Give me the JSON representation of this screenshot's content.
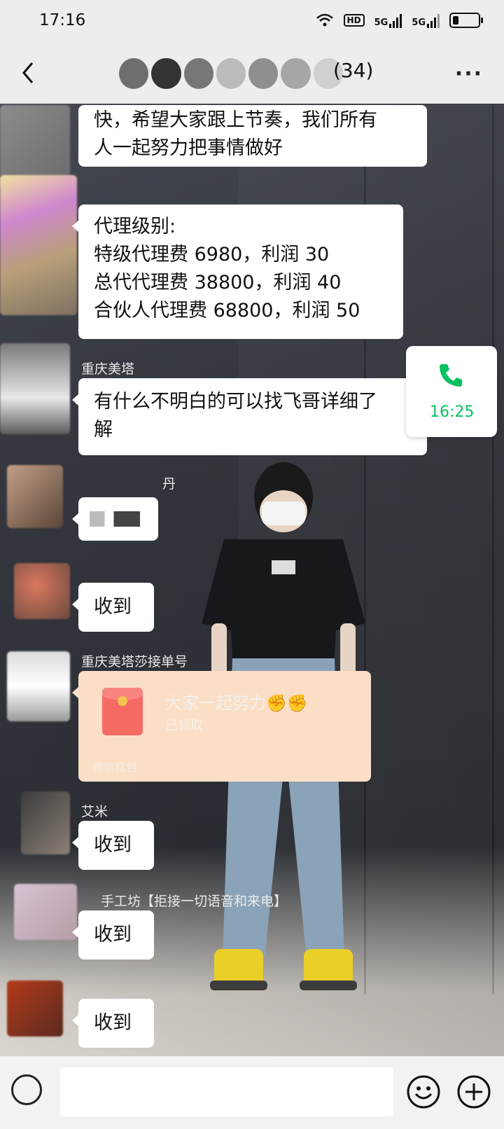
{
  "status_bar": {
    "time": "17:16",
    "hd_label": "HD",
    "net1": "5G",
    "net2": "5G"
  },
  "header": {
    "title_suffix": "(34)",
    "more_label": "···",
    "back_icon": "chevron-left-icon"
  },
  "messages": {
    "m1_line1": "快，希望大家跟上节奏，我们所有",
    "m1_line2": "人一起努力把事情做好",
    "m2_line1": "代理级别:",
    "m2_line2": "特级代理费 6980，利润 30",
    "m2_line3": "总代代理费 38800，利润 40",
    "m2_line4": "合伙人代理费 68800，利润 50",
    "m3_sender": "重庆美塔",
    "m3_line1": "有什么不明白的可以找飞哥详细了",
    "m3_line2": "解",
    "m4_sender": "丹",
    "m5_text": "收到",
    "m6_sender": "重庆美塔莎接单号",
    "m7_sender": "艾米",
    "m7_text": "收到",
    "m8_sender": "手工坊【拒接一切语音和来电】",
    "m8_text": "收到",
    "m9_text": "收到"
  },
  "red_packet": {
    "title": "大家一起努力✊✊",
    "status": "已领取",
    "footer": "微信红包"
  },
  "call": {
    "time": "16:25",
    "icon": "phone-icon"
  },
  "input_bar": {
    "voice_icon": "voice-icon",
    "emoji_icon": "emoji-icon",
    "plus_icon": "plus-icon"
  },
  "colors": {
    "bar_bg": "#ededed",
    "bubble": "#ffffff",
    "red_packet": "#fadfc6",
    "accent_green": "#07c160"
  }
}
